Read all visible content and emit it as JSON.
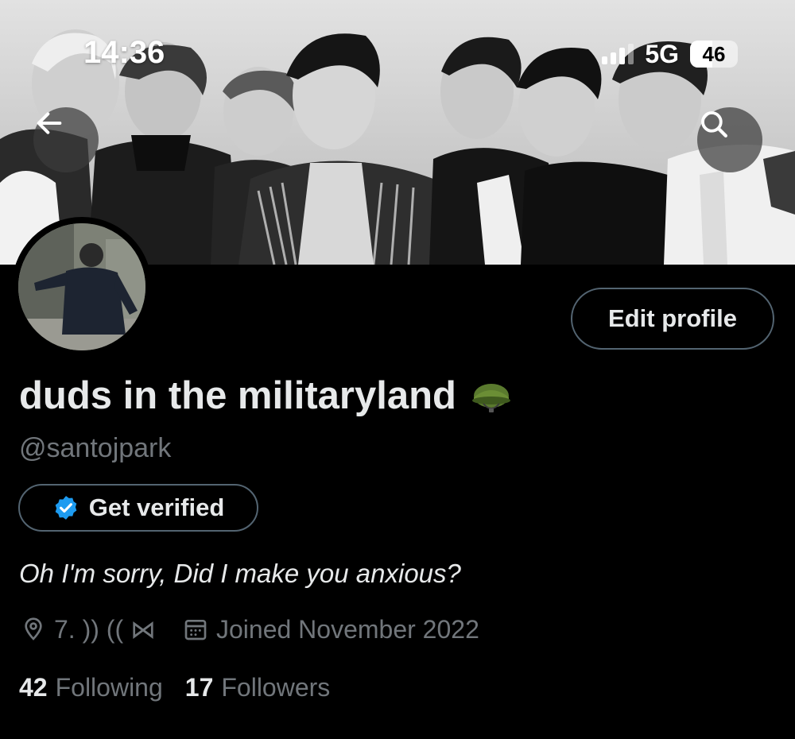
{
  "status_bar": {
    "time": "14:36",
    "network": "5G",
    "battery": "46",
    "battery_level": 0.46
  },
  "header": {
    "back_icon": "arrow-left-icon",
    "search_icon": "search-icon"
  },
  "profile": {
    "display_name": "duds in the militaryland",
    "name_emoji": "military-helmet-emoji",
    "handle": "@santojpark",
    "edit_button_label": "Edit profile",
    "verify_button_label": "Get verified",
    "bio": "Oh I'm sorry, Did I make you anxious?",
    "location": "7. )) ((  ⋈",
    "joined": "Joined November 2022",
    "following_count": "42",
    "following_label": "Following",
    "followers_count": "17",
    "followers_label": "Followers"
  },
  "colors": {
    "background": "#000000",
    "primary_text": "#e7e9ea",
    "secondary_text": "#71767b",
    "border": "#536471",
    "verified_blue": "#1d9bf0"
  }
}
